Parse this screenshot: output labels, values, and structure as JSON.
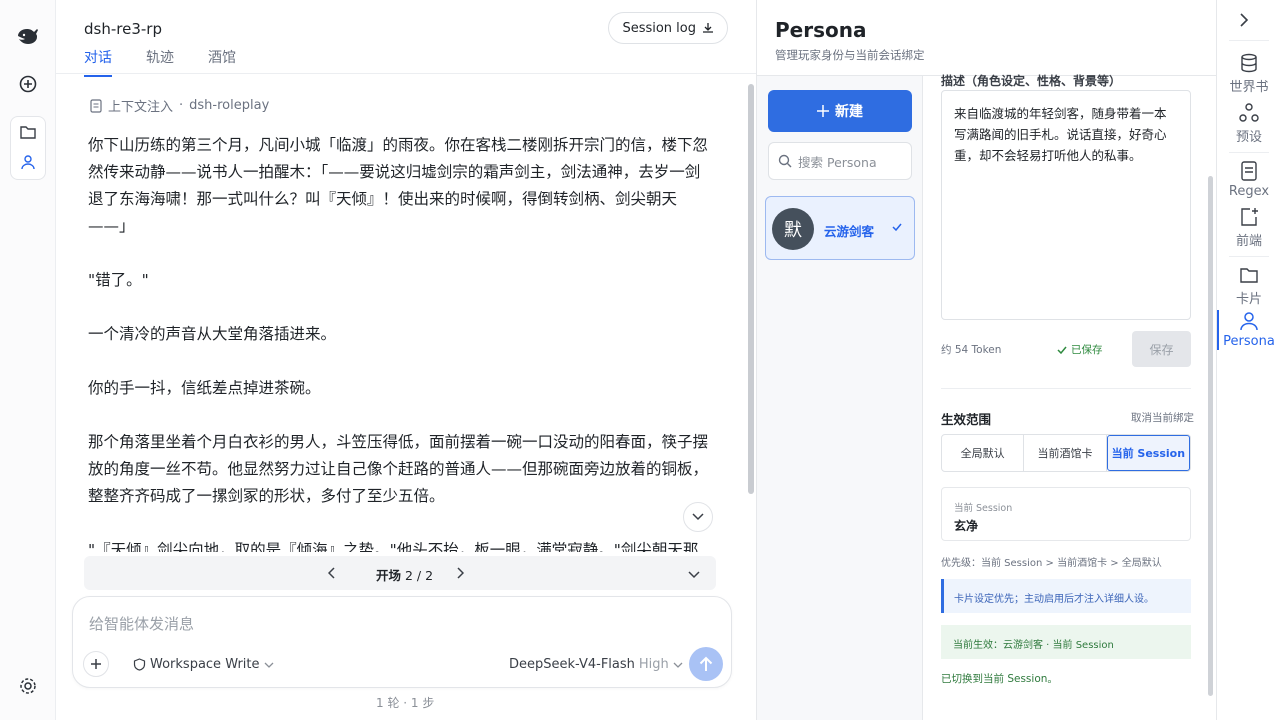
{
  "chat": {
    "title": "dsh-re3-rp",
    "tabs": [
      "对话",
      "轨迹",
      "酒馆"
    ],
    "session_log": "Session log",
    "context_label": "上下文注入",
    "context_value": "dsh-roleplay",
    "paragraphs": [
      "你下山历练的第三个月，凡间小城「临渡」的雨夜。你在客栈二楼刚拆开宗门的信，楼下忽然传来动静——说书人一拍醒木：「——要说这归墟剑宗的霜声剑主，剑法通神，去岁一剑退了东海海啸！那一式叫什么？叫『天倾』！使出来的时候啊，得倒转剑柄、剑尖朝天——」",
      "\"错了。\"",
      "一个清冷的声音从大堂角落插进来。",
      "你的手一抖，信纸差点掉进茶碗。",
      "那个角落里坐着个月白衣衫的男人，斗笠压得低，面前摆着一碗一口没动的阳春面，筷子摆放的角度一丝不苟。他显然努力过让自己像个赶路的普通人——但那碗面旁边放着的铜板，整整齐齐码成了一摞剑冢的形状，多付了至少五倍。",
      "\"『天倾』剑尖向地，取的是『倾海』之势。\"他头不抬，板一眼，满堂寂静。\"剑尖朝天那"
    ],
    "pager": {
      "label": "开场",
      "page": "2 / 2"
    },
    "composer": {
      "placeholder": "给智能体发消息",
      "workspace": "Workspace Write",
      "model": "DeepSeek-V4-Flash",
      "level": "High"
    },
    "footer": "1 轮 · 1 步"
  },
  "persona": {
    "title": "Persona",
    "subtitle": "管理玩家身份与当前会话绑定",
    "new_label": "新建",
    "search_placeholder": "搜索 Persona",
    "card": {
      "avatar": "默",
      "name": "云游剑客"
    },
    "desc_label": "描述（角色设定、性格、背景等）",
    "description": "来自临渡城的年轻剑客，随身带着一本写满路闻的旧手札。说话直接，好奇心重，却不会轻易打听他人的私事。",
    "tokens": "约 54 Token",
    "saved": "已保存",
    "save": "保存",
    "scope_label": "生效范围",
    "unbind": "取消当前绑定",
    "scopes": [
      "全局默认",
      "当前酒馆卡",
      "当前 Session"
    ],
    "current_session_key": "当前 Session",
    "current_session_value": "玄净",
    "priority": "优先级：当前 Session > 当前酒馆卡 > 全局默认",
    "note_blue": "卡片设定优先；主动启用后才注入详细人设。",
    "note_green": "当前生效：云游剑客 · 当前 Session",
    "switched": "已切换到当前 Session。"
  },
  "right_rail": [
    "世界书",
    "预设",
    "Regex",
    "前端",
    "卡片",
    "Persona"
  ],
  "colors": {
    "accent": "#2563eb",
    "primary_button": "#2f6de1"
  }
}
